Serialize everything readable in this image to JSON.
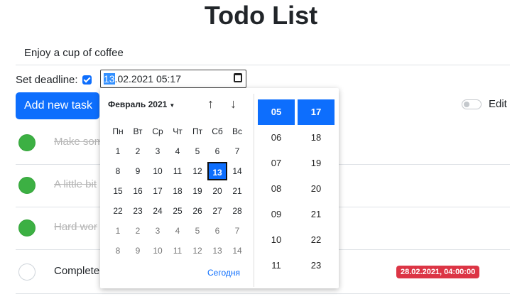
{
  "page": {
    "title": "Todo List"
  },
  "new_task": {
    "value": "Enjoy a cup of coffee"
  },
  "deadline": {
    "label": "Set deadline:",
    "checked": true,
    "value_selected": "13",
    "value_rest": ".02.2021 05:17"
  },
  "add_button": {
    "label": "Add new task"
  },
  "edit_toggle": {
    "label": "Edit"
  },
  "tasks": [
    {
      "text": "Make som",
      "done": true
    },
    {
      "text": "A little bit",
      "done": true
    },
    {
      "text": "Hard wor",
      "done": true
    },
    {
      "text": "Complete",
      "done": false,
      "badge": "28.02.2021, 04:00:00"
    }
  ],
  "picker": {
    "month_label": "Февраль 2021",
    "weekdays": [
      "Пн",
      "Вт",
      "Ср",
      "Чт",
      "Пт",
      "Сб",
      "Вс"
    ],
    "weeks": [
      [
        "1",
        "2",
        "3",
        "4",
        "5",
        "6",
        "7"
      ],
      [
        "8",
        "9",
        "10",
        "11",
        "12",
        "13",
        "14"
      ],
      [
        "15",
        "16",
        "17",
        "18",
        "19",
        "20",
        "21"
      ],
      [
        "22",
        "23",
        "24",
        "25",
        "26",
        "27",
        "28"
      ],
      [
        "1",
        "2",
        "3",
        "4",
        "5",
        "6",
        "7"
      ],
      [
        "8",
        "9",
        "10",
        "11",
        "12",
        "13",
        "14"
      ]
    ],
    "selected_day": "13",
    "today_label": "Сегодня",
    "hours": [
      "05",
      "06",
      "07",
      "08",
      "09",
      "10",
      "11"
    ],
    "minutes": [
      "17",
      "18",
      "19",
      "20",
      "21",
      "22",
      "23"
    ],
    "selected_hour": "05",
    "selected_minute": "17"
  },
  "colors": {
    "accent": "#0d6efd",
    "done": "#3cb043",
    "badge": "#dc3545"
  }
}
